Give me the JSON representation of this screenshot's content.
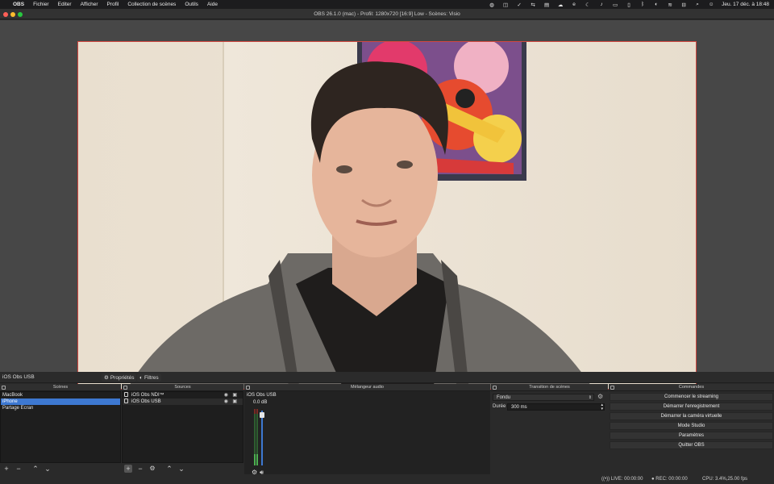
{
  "menubar": {
    "app_name": "OBS",
    "items": [
      "Fichier",
      "Editer",
      "Afficher",
      "Profil",
      "Collection de scènes",
      "Outils",
      "Aide"
    ],
    "datetime": "Jeu. 17 déc. à 18:48"
  },
  "window": {
    "title": "OBS 26.1.0 (mac) - Profil: 1280x720 [16:9] Low - Scènes: Visio"
  },
  "context_bar": {
    "source_name": "iOS Obs USB",
    "properties_label": "Propriétés",
    "filters_label": "Filtres"
  },
  "scenes": {
    "header": "Scènes",
    "items": [
      "MacBook",
      "iPhone",
      "Partage Ecran"
    ],
    "selected_index": 1
  },
  "sources": {
    "header": "Sources",
    "items": [
      "iOS Obs NDI™",
      "iOS Obs USB"
    ]
  },
  "mixer": {
    "header": "Mélangeur audio",
    "channel_name": "iOS Obs USB",
    "level": "0.0 dB"
  },
  "transitions": {
    "header": "Transition de scènes",
    "selected": "Fondu",
    "duration_label": "Durée",
    "duration_value": "300 ms"
  },
  "controls": {
    "header": "Commandes",
    "buttons": [
      "Commencer le streaming",
      "Démarrer l'enregistrement",
      "Démarrer la caméra virtuelle",
      "Mode Studio",
      "Paramètres",
      "Quitter OBS"
    ]
  },
  "status": {
    "live": "LIVE: 00:00:00",
    "rec": "REC: 00:00:00",
    "cpu": "CPU: 3.4%,25.00 fps"
  },
  "colors": {
    "accent": "#3d78d1",
    "preview_border": "#d0473f",
    "panel_bg": "#2a2a2a"
  }
}
